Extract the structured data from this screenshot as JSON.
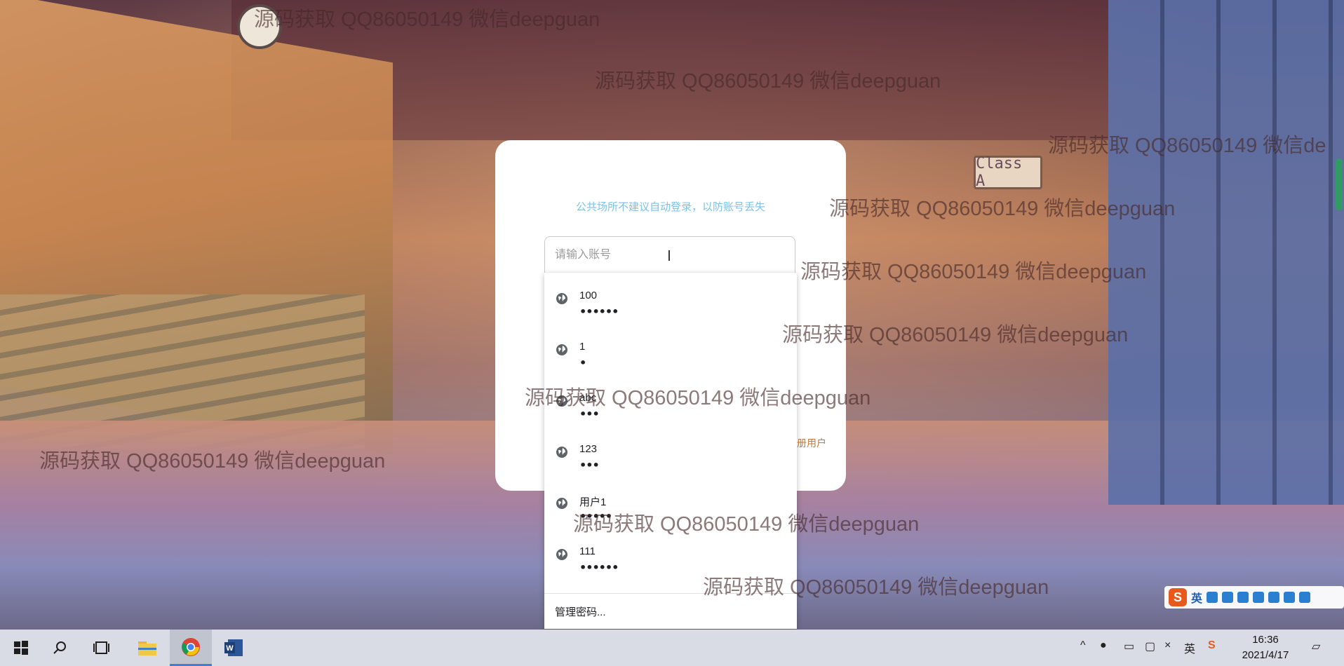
{
  "watermark_text": "源码获取 QQ86050149 微信deepguan",
  "watermark_text_cut": "源码获取 QQ86050149 微信de",
  "login": {
    "notice": "公共场所不建议自动登录，以防账号丢失",
    "account_placeholder": "请输入账号",
    "register_partial": "册用户"
  },
  "autofill": {
    "items": [
      {
        "username": "100",
        "password_mask": "••••••"
      },
      {
        "username": "1",
        "password_mask": "•"
      },
      {
        "username": "abc",
        "password_mask": "•••"
      },
      {
        "username": "123",
        "password_mask": "•••"
      },
      {
        "username": "用户1",
        "password_mask": "•••••"
      },
      {
        "username": "111",
        "password_mask": "••••••"
      }
    ],
    "manage_label": "管理密码..."
  },
  "background": {
    "class_sign": "Class A"
  },
  "ime": {
    "logo": "S",
    "lang": "英"
  },
  "taskbar": {
    "tray_lang": "英",
    "time": "16:36",
    "date": "2021/4/17"
  },
  "colors": {
    "notice": "#7ec2e6",
    "register_link": "#c0793b",
    "taskbar": "#d9dce4"
  }
}
